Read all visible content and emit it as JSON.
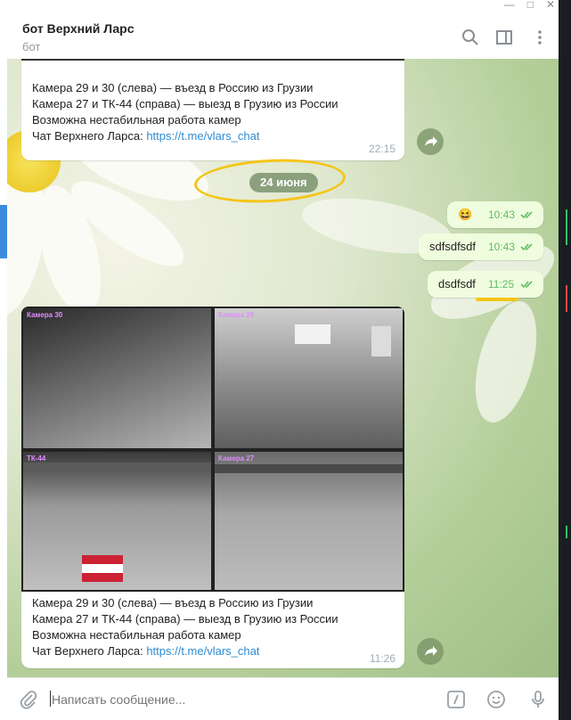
{
  "window": {
    "minimize": "—",
    "maximize": "□",
    "close": "✕"
  },
  "header": {
    "title": "бот Верхний Ларс",
    "subtitle": "бот",
    "icons": [
      "search-icon",
      "sidebar-toggle-icon",
      "more-icon"
    ]
  },
  "messages": {
    "first": {
      "lines": [
        "Камера 29 и 30 (слева) — въезд в Россию из Грузии",
        "Камера 27 и ТК-44 (справа) — выезд в Грузию из России",
        "Возможна нестабильная работа камер"
      ],
      "link_prefix": "Чат Верхнего Ларса: ",
      "link": "https://t.me/vlars_chat",
      "time": "22:15"
    },
    "date": "24 июня",
    "outgoing": [
      {
        "text": "😆",
        "time": "10:43"
      },
      {
        "text": "sdfsdfsdf",
        "time": "10:43"
      },
      {
        "text": "dsdfsdf",
        "time": "11:25"
      }
    ],
    "second": {
      "camera_labels": [
        "Камера 30",
        "Камера 29",
        "ТК-44",
        "Камера 27"
      ],
      "lines": [
        "Камера 29 и 30 (слева) — въезд в Россию из Грузии",
        "Камера 27 и ТК-44 (справа) — выезд в Грузию из России",
        "Возможна нестабильная работа камер"
      ],
      "link_prefix": "Чат Верхнего Ларса: ",
      "link": "https://t.me/vlars_chat",
      "time": "11:26"
    }
  },
  "composer": {
    "placeholder": "Написать сообщение...",
    "icons": [
      "attach-icon",
      "commands-icon",
      "emoji-icon",
      "microphone-icon"
    ]
  },
  "colors": {
    "link": "#2f8cd2",
    "outgoing_bubble": "#effdde",
    "check": "#5dbd63",
    "annotation": "#f5c518"
  }
}
